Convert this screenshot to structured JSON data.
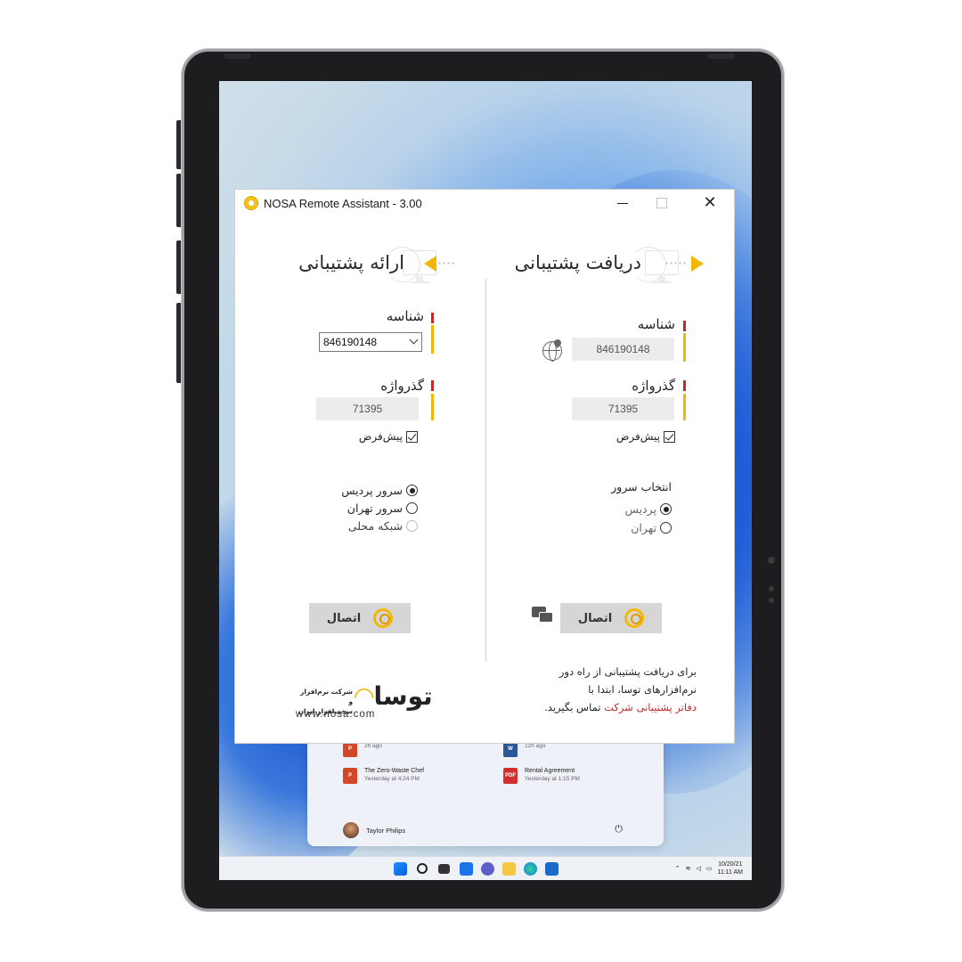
{
  "window": {
    "title": "NOSA Remote Assistant - 3.00",
    "close_glyph": "✕"
  },
  "receive": {
    "heading": "دریافت پشتیبانی",
    "id_label": "شناسه",
    "id_value": "846190148",
    "password_label": "گذرواژه",
    "password_value": "71395",
    "default_label": "پیش‌فرض",
    "server_group_title": "انتخاب سرور",
    "servers": [
      "پردیس",
      "تهران"
    ],
    "connect_label": "اتصال",
    "info_line1": "برای دریافت پشتیبانی از راه دور",
    "info_line2": "نرم‌افزارهای توسا، ابتدا با",
    "info_red": "دفاتر پشتیبانی شرکت",
    "info_tail": " تماس بگیرید."
  },
  "provide": {
    "heading": "ارائه پشتیبانی",
    "id_label": "شناسه",
    "id_value": "846190148",
    "password_label": "گذرواژه",
    "password_value": "71395",
    "default_label": "پیش‌فرض",
    "servers": [
      "سرور پردیس",
      "سرور تهران",
      "شبکه محلی"
    ],
    "connect_label": "اتصال"
  },
  "brand": {
    "logo_text": "توسا",
    "subtitle_line1": "شرکت نرم‌افزار و",
    "subtitle_line2": "سخت‌افزار ایران",
    "url": "www.nosa.com"
  },
  "startmenu": {
    "items": [
      {
        "name": "The Zero-Waste Chef",
        "time": "Yesterday at 4:24 PM",
        "type": "P"
      },
      {
        "name": "Rental Agreement",
        "time": "Yesterday at 1:15 PM",
        "type": "PDF"
      }
    ],
    "partial_times": [
      "2h ago",
      "12h ago"
    ],
    "user": "Taylor Philips"
  },
  "taskbar": {
    "date": "10/20/21",
    "time": "11:11 AM"
  },
  "colors": {
    "accent_yellow": "#f2b705",
    "accent_red": "#c62828"
  }
}
